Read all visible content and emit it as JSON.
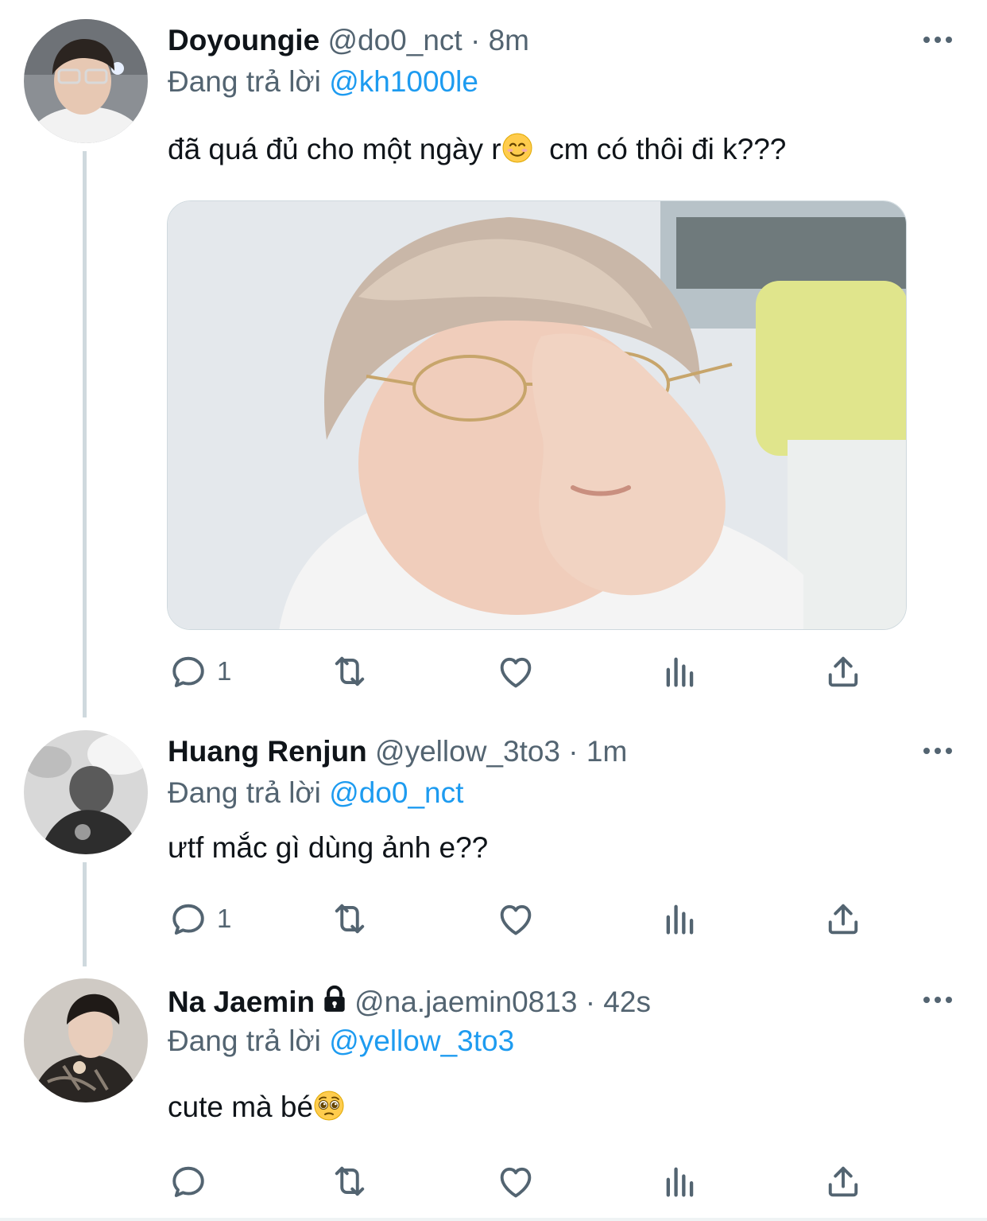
{
  "tweets": [
    {
      "name": "Doyoungie",
      "handle": "@do0_nct",
      "separator": "·",
      "time": "8m",
      "reply_prefix": "Đang trả lời",
      "reply_to": "@kh1000le",
      "text_before_emoji": "đã quá đủ cho một ngày r",
      "emoji": "smiling-face-icon",
      "text_after_emoji": "  cm có thôi đi k???",
      "has_media": true,
      "reply_count": "1"
    },
    {
      "name": "Huang Renjun",
      "handle": "@yellow_3to3",
      "separator": "·",
      "time": "1m",
      "reply_prefix": "Đang trả lời",
      "reply_to": "@do0_nct",
      "text": "ưtf mắc gì dùng ảnh e??",
      "reply_count": "1"
    },
    {
      "name": "Na Jaemin",
      "protected_icon": "lock-icon",
      "handle": "@na.jaemin0813",
      "separator": "·",
      "time": "42s",
      "reply_prefix": "Đang trả lời",
      "reply_to": "@yellow_3to3",
      "text": "cute mà bé",
      "emoji": "pleading-face-icon",
      "reply_count": ""
    }
  ],
  "icons": {
    "more": "more-icon",
    "reply": "reply-icon",
    "retweet": "retweet-icon",
    "like": "like-icon",
    "views": "views-icon",
    "share": "share-icon"
  },
  "colors": {
    "text": "#0f1419",
    "secondary": "#536471",
    "mention": "#1d9bf0",
    "thread_line": "#cfd9de"
  }
}
